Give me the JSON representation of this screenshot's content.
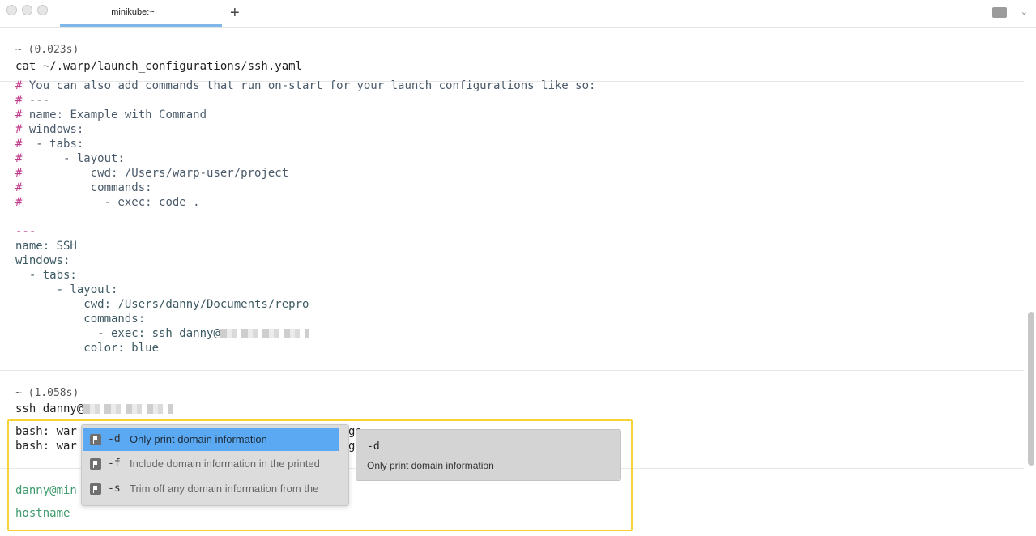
{
  "window": {
    "tab_title": "minikube:~",
    "new_tab_icon": "+",
    "window_menu_icon": "sidebar-icon"
  },
  "block1": {
    "duration": "~ (0.023s)",
    "command": "cat ~/.warp/launch_configurations/ssh.yaml",
    "output": [
      "# You can also add commands that run on-start for your launch configurations like so:",
      "# ---",
      "# name: Example with Command",
      "# windows:",
      "#  - tabs:",
      "#      - layout:",
      "#          cwd: /Users/warp-user/project",
      "#          commands:",
      "#            - exec: code .",
      "",
      "---",
      "name: SSH",
      "windows:",
      "  - tabs:",
      "      - layout:",
      "          cwd: /Users/danny/Documents/repro",
      "          commands:",
      "            - exec: ssh danny@",
      "          color: blue"
    ]
  },
  "block2": {
    "duration": "~ (1.058s)",
    "command": "ssh danny@",
    "output_line1": "bash: war",
    "output_line2": "bash: war",
    "output_line1_tail": "ge",
    "output_line2_tail": "ge"
  },
  "prompt": {
    "user": "danny@min",
    "input": "hostname"
  },
  "completion_menu": {
    "items": [
      {
        "option": "-d",
        "description": "Only print domain information",
        "selected": true
      },
      {
        "option": "-f",
        "description": "Include domain information in the printed",
        "selected": false
      },
      {
        "option": "-s",
        "description": "Trim off any domain information from the",
        "selected": false
      }
    ]
  },
  "detail_panel": {
    "title": "-d",
    "description": "Only print domain information"
  }
}
